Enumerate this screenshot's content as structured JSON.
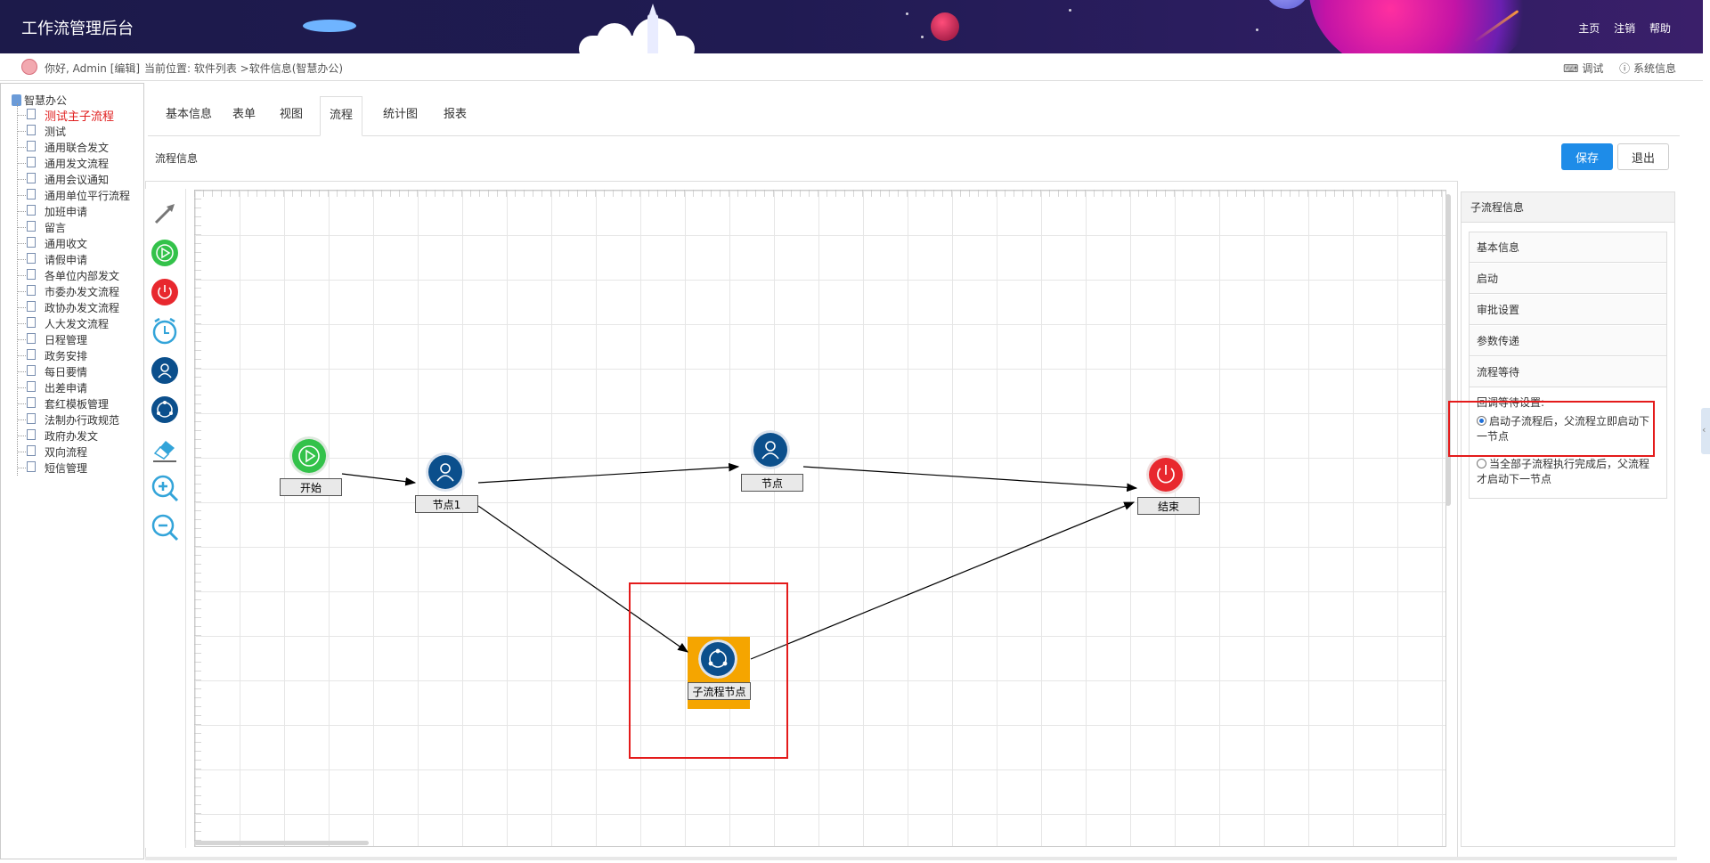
{
  "header": {
    "app_title": "工作流管理后台",
    "links": [
      "主页",
      "注销",
      "帮助"
    ]
  },
  "infobar": {
    "greeting": "你好, Admin",
    "edit_label": "[编辑]",
    "breadcrumb": "当前位置: 软件列表 >软件信息(智慧办公)",
    "tools": [
      "调试",
      "系统信息"
    ]
  },
  "tree": {
    "root": "智慧办公",
    "items": [
      "测试主子流程",
      "测试",
      "通用联合发文",
      "通用发文流程",
      "通用会议通知",
      "通用单位平行流程",
      "加班申请",
      "留言",
      "通用收文",
      "请假申请",
      "各单位内部发文",
      "市委办发文流程",
      "政协办发文流程",
      "人大发文流程",
      "日程管理",
      "政务安排",
      "每日要情",
      "出差申请",
      "套红模板管理",
      "法制办行政规范",
      "政府办发文",
      "双向流程",
      "短信管理"
    ],
    "active_index": 0
  },
  "tabs": [
    "基本信息",
    "表单",
    "视图",
    "流程",
    "统计图",
    "报表"
  ],
  "active_tab": "流程",
  "section_title": "流程信息",
  "buttons": {
    "save": "保存",
    "exit": "退出"
  },
  "toolbar_icons": [
    "arrow-connector-icon",
    "start-node-icon",
    "end-node-icon",
    "timer-node-icon",
    "user-task-icon",
    "subprocess-icon",
    "eraser-icon",
    "zoom-in-icon",
    "zoom-out-icon"
  ],
  "workflow": {
    "nodes": {
      "start": "开始",
      "node1": "节点1",
      "node": "节点",
      "end": "结束",
      "subprocess": "子流程节点"
    },
    "colors": {
      "start": "#33c24a",
      "end": "#e8282e",
      "task": "#0b4f8c",
      "highlight": "#f5a500",
      "annotation": "#e41b1b"
    }
  },
  "panel": {
    "title": "子流程信息",
    "sections": [
      "基本信息",
      "启动",
      "审批设置",
      "参数传递",
      "流程等待"
    ],
    "wait_label": "回调等待设置:",
    "options": [
      {
        "label_line1": "启动子流程后，父流程立即启动下",
        "label_line2": "一节点",
        "selected": true
      },
      {
        "label_line1": "当全部子流程执行完成后，父流程",
        "label_line2": "才启动下一节点",
        "selected": false
      }
    ]
  }
}
